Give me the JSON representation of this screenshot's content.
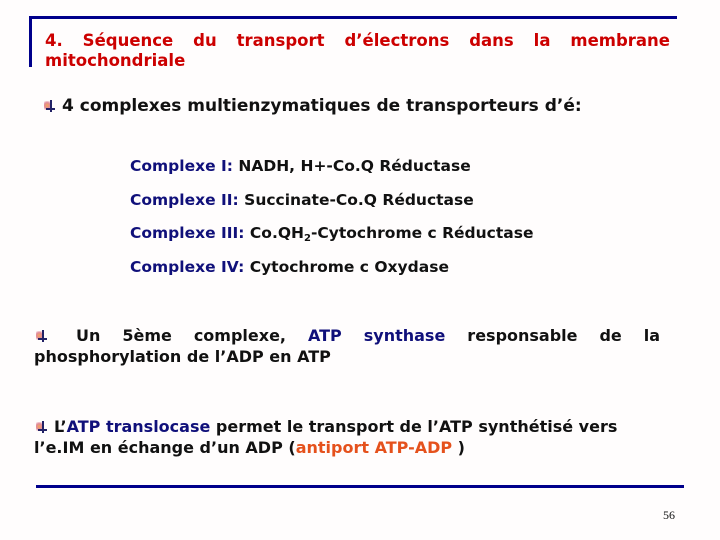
{
  "title": {
    "line1": "4. Séquence du transport d’électrons dans la membrane",
    "line2": "mitochondriale"
  },
  "intro": {
    "bullet_icon": "pushpin-bullet-icon",
    "text": "4 complexes multienzymatiques de transporteurs d’é:"
  },
  "complexes": [
    {
      "label": "Complexe I:",
      "desc": "NADH, H+-Co.Q Réductase"
    },
    {
      "label": "Complexe II:",
      "desc": "Succinate-Co.Q Réductase"
    },
    {
      "label": "Complexe III:",
      "desc_pre": "Co.QH",
      "desc_sub": "2",
      "desc_post": "-Cytochrome c Réductase"
    },
    {
      "label": "Complexe IV:",
      "desc": "Cytochrome c Oxydase"
    }
  ],
  "fifth": {
    "pre": "Un 5ème complexe,",
    "highlight": "ATP synthase",
    "post": "responsable de la",
    "line2": "phosphorylation de l’ADP en ATP"
  },
  "translocase": {
    "pre": "L’",
    "highlight": "ATP translocase",
    "post": "permet le transport de l’ATP synthétisé vers",
    "line2_pre": "l’e.IM en échange d’un ADP (",
    "line2_highlight": "antiport ATP-ADP",
    "line2_post": " )"
  },
  "page_number": "56",
  "colors": {
    "title": "#cc0000",
    "rule": "#00008b",
    "label_blue": "#10107a",
    "highlight_orange": "#e5511c"
  }
}
